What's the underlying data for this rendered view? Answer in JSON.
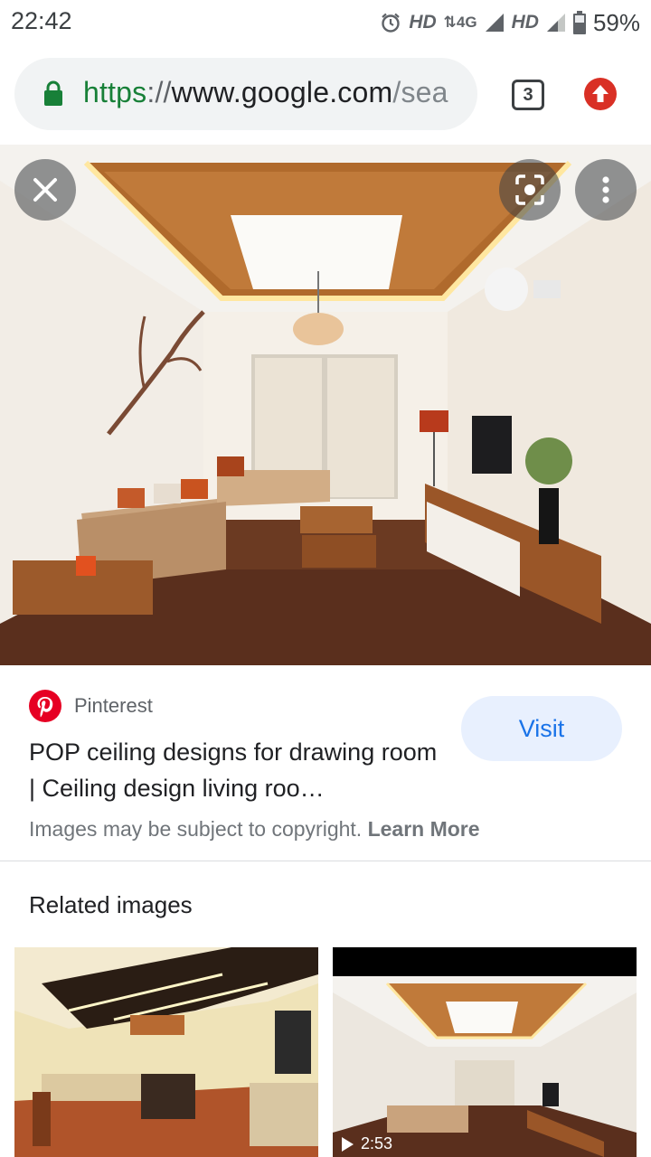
{
  "status_bar": {
    "time": "22:42",
    "signal_1": "HD",
    "network": "4G",
    "signal_2": "HD",
    "battery": "59%"
  },
  "browser": {
    "url_scheme": "https",
    "url_sep": "://",
    "url_host": "www.google.com",
    "url_rest": "/sea",
    "tab_count": "3"
  },
  "result": {
    "source": "Pinterest",
    "title": "POP ceiling designs for drawing room | Ceiling design living roo…",
    "visit_label": "Visit",
    "copyright_text": "Images may be subject to copyright.",
    "learn_more_label": "Learn More"
  },
  "related": {
    "heading": "Related images",
    "items": [
      {
        "type": "image"
      },
      {
        "type": "video",
        "duration": "2:53"
      }
    ]
  },
  "colors": {
    "secure_green": "#188038",
    "visit_blue": "#1a73e8",
    "pinterest_red": "#e60023",
    "update_red": "#d93025"
  }
}
